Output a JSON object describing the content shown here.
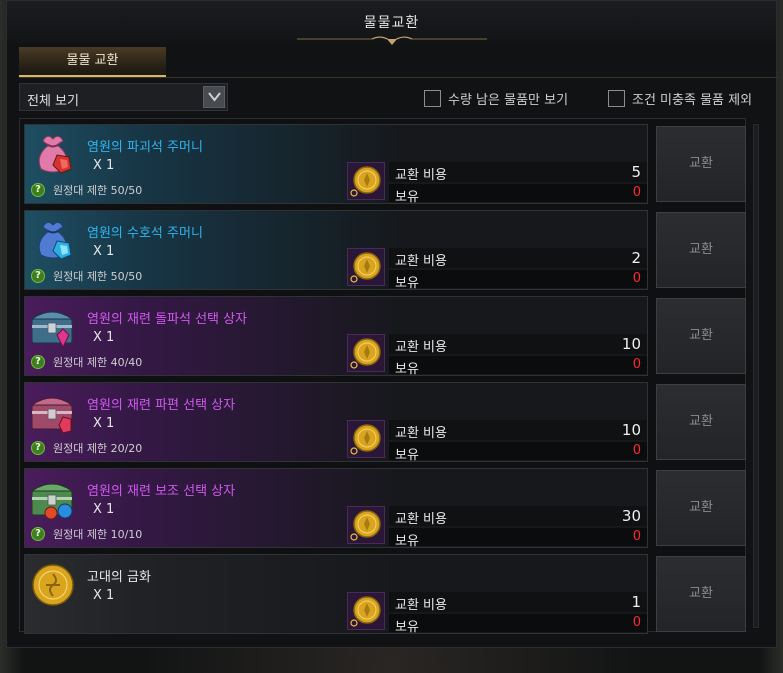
{
  "window": {
    "title": "물물교환"
  },
  "tabs": [
    {
      "label": "물물 교환"
    }
  ],
  "filter": {
    "dropdown_label": "전체 보기",
    "checkbox_remaining": "수량 남은 물품만 보기",
    "checkbox_exclude": "조건 미충족 물품 제외"
  },
  "colors": {
    "name_blue": "#2fb4ef",
    "name_purple": "#d158f0",
    "name_white": "#e8e8e8",
    "owned_red": "#ff2a2a"
  },
  "items": [
    {
      "name": "염원의 파괴석 주머니",
      "qty": "X 1",
      "limit": "원정대 제한 50/50",
      "cost_label": "교환 비용",
      "cost_value": "5",
      "own_label": "보유",
      "own_value": "0",
      "button": "교환",
      "icon": "pink-pouch-icon",
      "rarity": "blue"
    },
    {
      "name": "염원의 수호석 주머니",
      "qty": "X 1",
      "limit": "원정대 제한 50/50",
      "cost_label": "교환 비용",
      "cost_value": "2",
      "own_label": "보유",
      "own_value": "0",
      "button": "교환",
      "icon": "blue-pouch-icon",
      "rarity": "blue"
    },
    {
      "name": "염원의 재련 돌파석 선택 상자",
      "qty": "X 1",
      "limit": "원정대 제한 40/40",
      "cost_label": "교환 비용",
      "cost_value": "10",
      "own_label": "보유",
      "own_value": "0",
      "button": "교환",
      "icon": "chest-icon",
      "rarity": "purple"
    },
    {
      "name": "염원의 재련 파편 선택 상자",
      "qty": "X 1",
      "limit": "원정대 제한 20/20",
      "cost_label": "교환 비용",
      "cost_value": "10",
      "own_label": "보유",
      "own_value": "0",
      "button": "교환",
      "icon": "chest-icon",
      "rarity": "purple"
    },
    {
      "name": "염원의 재련 보조 선택 상자",
      "qty": "X 1",
      "limit": "원정대 제한 10/10",
      "cost_label": "교환 비용",
      "cost_value": "30",
      "own_label": "보유",
      "own_value": "0",
      "button": "교환",
      "icon": "chest-icon",
      "rarity": "purple"
    },
    {
      "name": "고대의 금화",
      "qty": "X 1",
      "limit": "",
      "cost_label": "교환 비용",
      "cost_value": "1",
      "own_label": "보유",
      "own_value": "0",
      "button": "교환",
      "icon": "gold-coin-icon",
      "rarity": "white"
    }
  ]
}
